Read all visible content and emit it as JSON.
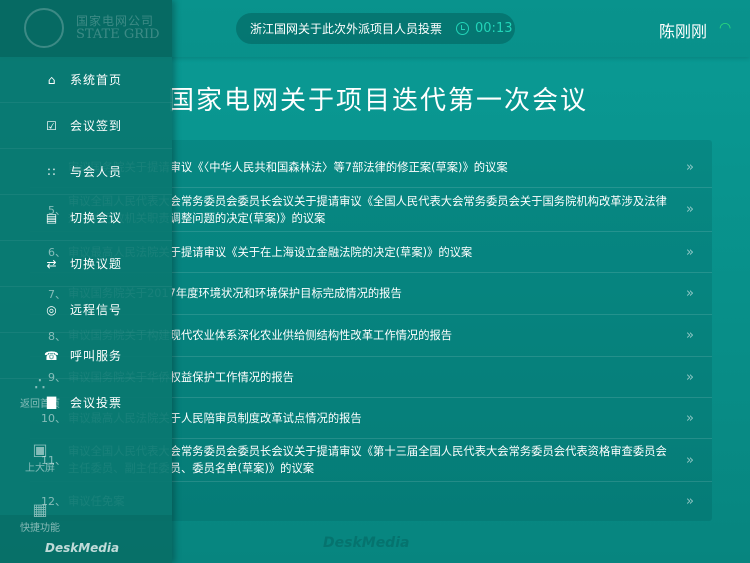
{
  "header": {
    "vote_title": "浙江国网关于此次外派项目人员投票",
    "timer": "00:13",
    "user": "陈刚刚"
  },
  "meeting_title": "国家电网关于项目迭代第一次会议",
  "agenda": [
    {
      "num": "",
      "text": "审议国务院关于提请审议《〈中华人民共和国森林法〉等7部法律的修正案(草案)》的议案"
    },
    {
      "num": "5、",
      "text": "审议全国人民代表大会常务委员会委员长会议关于提请审议《全国人民代表大会常务委员会关于国务院机构改革涉及法律规定的行政机关职责调整问题的决定(草案)》的议案"
    },
    {
      "num": "6、",
      "text": "审议最高人民法院关于提请审议《关于在上海设立金融法院的决定(草案)》的议案"
    },
    {
      "num": "7、",
      "text": "审议国务院关于2017年度环境状况和环境保护目标完成情况的报告"
    },
    {
      "num": "8、",
      "text": "审议国务院关于构建现代农业体系深化农业供给侧结构性改革工作情况的报告"
    },
    {
      "num": "9、",
      "text": "审议国务院关于华侨权益保护工作情况的报告"
    },
    {
      "num": "10、",
      "text": "审议最高人民法院关于人民陪审员制度改革试点情况的报告"
    },
    {
      "num": "11、",
      "text": "审议全国人民代表大会常务委员会委员长会议关于提请审议《第十三届全国人民代表大会常务委员会代表资格审查委员会主任委员、副主任委员、委员名单(草案)》的议案"
    },
    {
      "num": "12、",
      "text": "审议任免案"
    }
  ],
  "dock": {
    "home": "返回首页",
    "screen": "上大屏",
    "quick": "快捷功能"
  },
  "logo": {
    "cn": "国家电网公司",
    "en": "STATE GRID"
  },
  "menu": [
    {
      "label": "系统首页",
      "icon": "home-icon"
    },
    {
      "label": "会议签到",
      "icon": "calendar-check-icon"
    },
    {
      "label": "与会人员",
      "icon": "people-icon"
    },
    {
      "label": "切换会议",
      "icon": "presentation-icon"
    },
    {
      "label": "切换议题",
      "icon": "swap-icon"
    },
    {
      "label": "远程信号",
      "icon": "signal-icon"
    },
    {
      "label": "呼叫服务",
      "icon": "phone-icon"
    },
    {
      "label": "会议投票",
      "icon": "bar-chart-icon"
    }
  ],
  "brand": "DeskMedia"
}
